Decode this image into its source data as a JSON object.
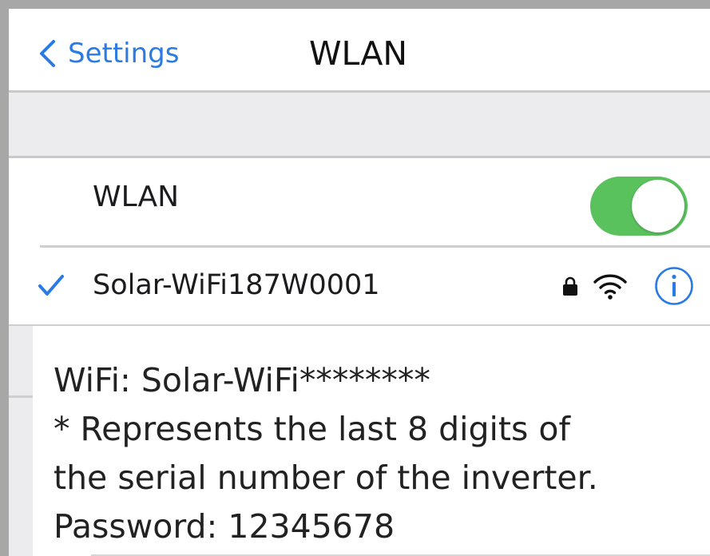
{
  "nav": {
    "back_label": "Settings",
    "title": "WLAN"
  },
  "wlan_row": {
    "label": "WLAN",
    "toggle_on": true
  },
  "network_row": {
    "name": "Solar-WiFi187W0001",
    "connected": true,
    "secured": true
  },
  "instructions": {
    "line1": "WiFi: Solar-WiFi********",
    "line2": "* Represents the last 8 digits of",
    "line3": "the serial number of the inverter.",
    "line4": "Password: 12345678"
  },
  "colors": {
    "accent_blue": "#2a7be4",
    "toggle_green": "#59c25d",
    "grouped_background": "#ececee",
    "separator": "#cfcfcf"
  },
  "icons": [
    "chevron-left-icon",
    "checkmark-icon",
    "lock-icon",
    "wifi-icon",
    "info-icon"
  ]
}
